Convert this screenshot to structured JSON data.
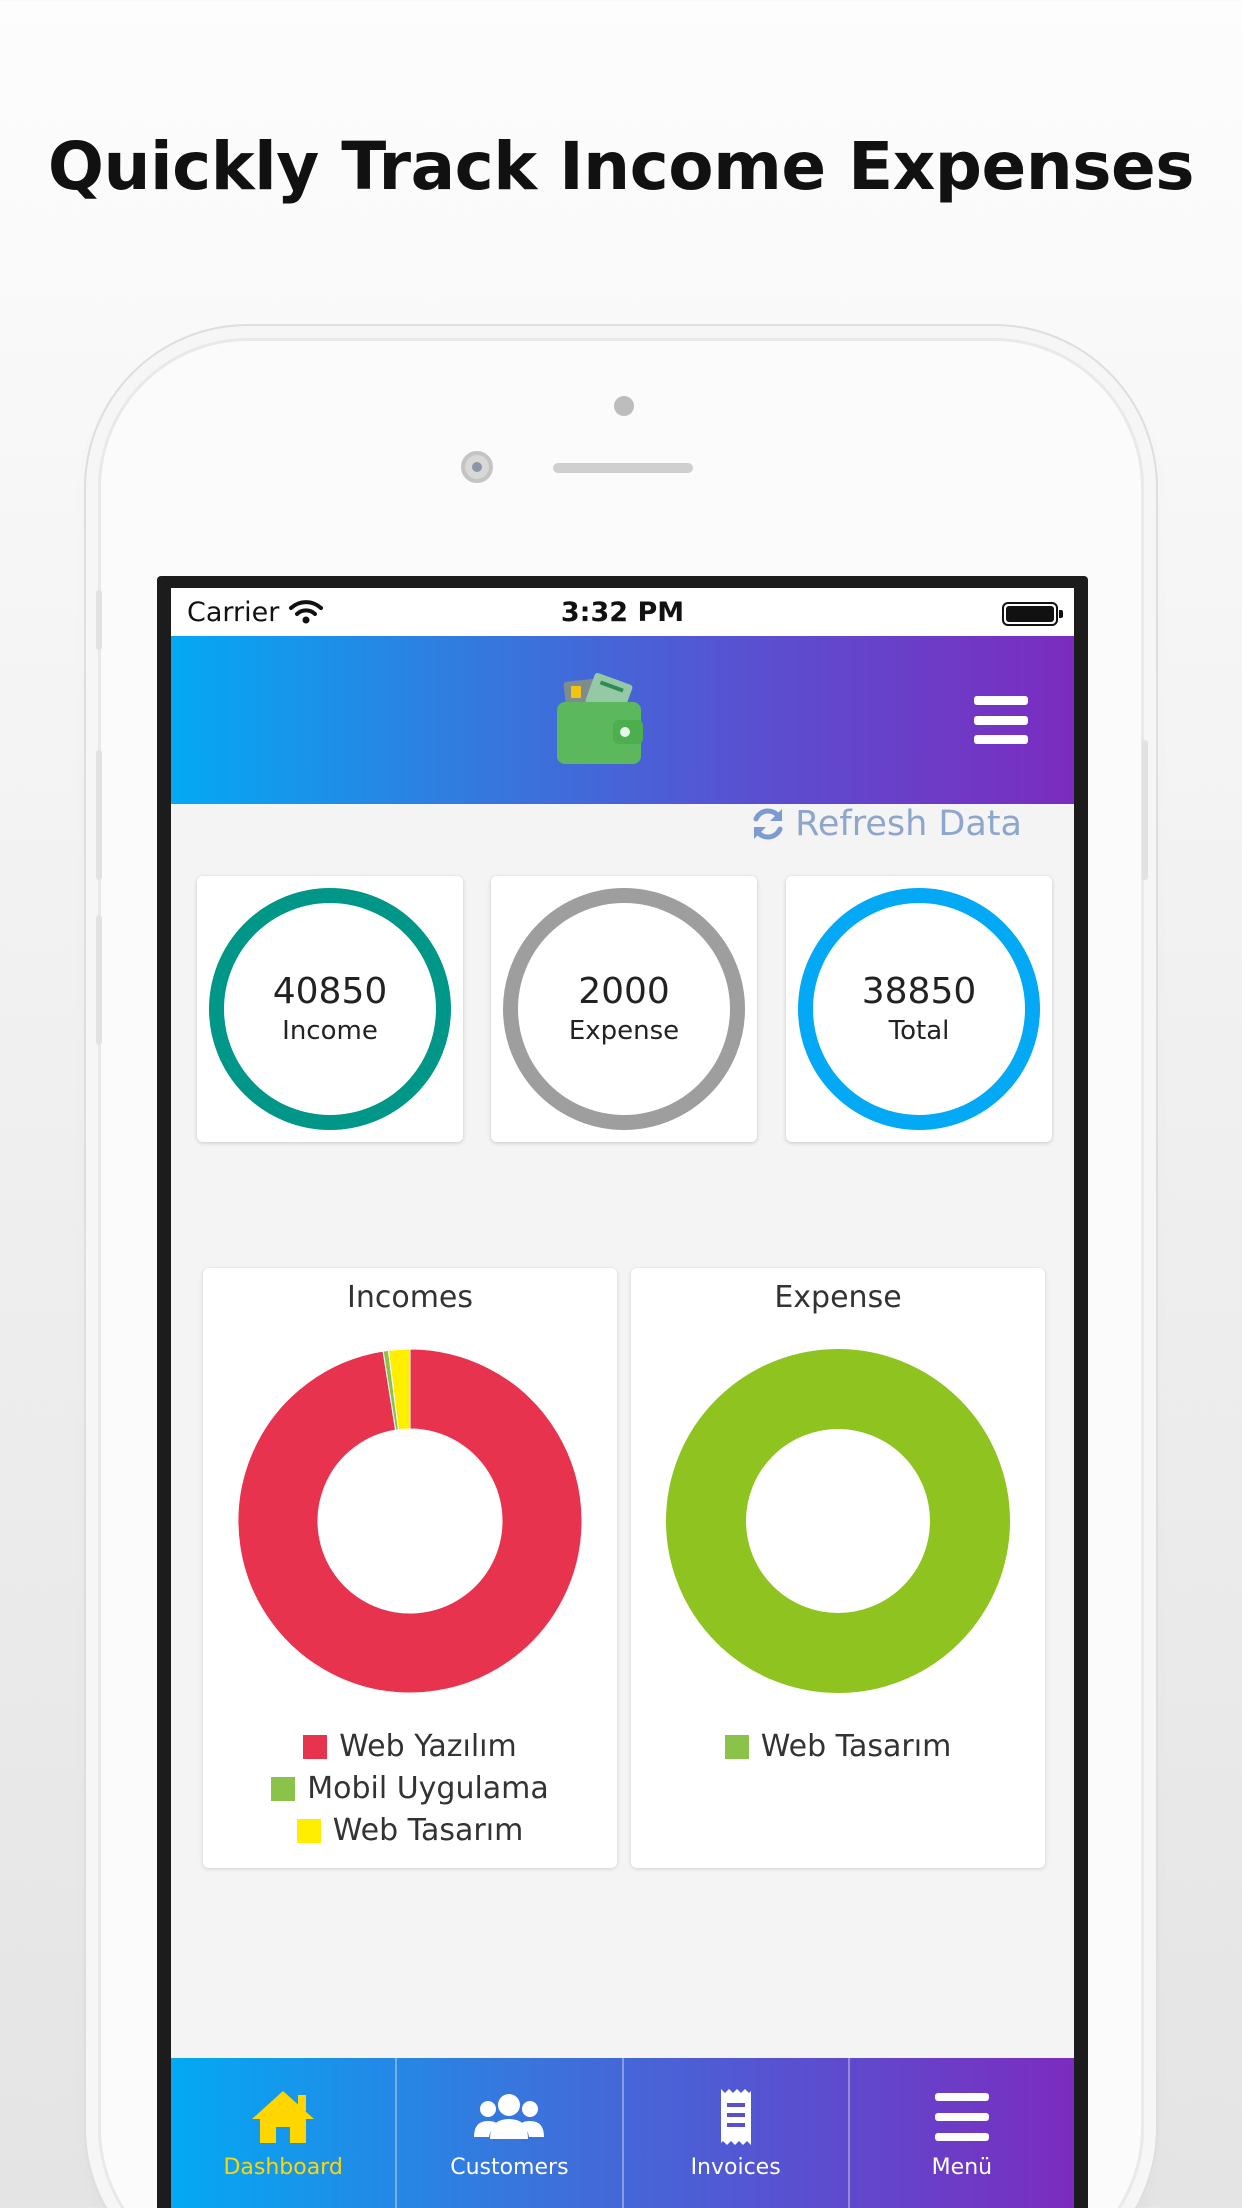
{
  "headline": "Quickly Track Income Expenses",
  "status_bar": {
    "carrier": "Carrier",
    "time": "3:32 PM"
  },
  "app_bar": {
    "logo_icon": "wallet-icon",
    "menu_icon": "hamburger-icon"
  },
  "refresh": {
    "label": "Refresh Data",
    "icon": "refresh-icon"
  },
  "stats": [
    {
      "value": "40850",
      "label": "Income",
      "color": "#009688"
    },
    {
      "value": "2000",
      "label": "Expense",
      "color": "#9e9e9e"
    },
    {
      "value": "38850",
      "label": "Total",
      "color": "#03a9f4"
    }
  ],
  "charts": {
    "incomes": {
      "title": "Incomes",
      "legend": [
        {
          "label": "Web Yazılım",
          "color": "#e8334f"
        },
        {
          "label": "Mobil Uygulama",
          "color": "#8bc34a"
        },
        {
          "label": "Web Tasarım",
          "color": "#ffee00"
        }
      ]
    },
    "expense": {
      "title": "Expense",
      "legend": [
        {
          "label": "Web Tasarım",
          "color": "#8bc34a"
        }
      ]
    }
  },
  "chart_data": [
    {
      "type": "pie",
      "title": "Incomes",
      "categories": [
        "Web Yazılım",
        "Mobil Uygulama",
        "Web Tasarım"
      ],
      "values": [
        97.5,
        0.5,
        2
      ],
      "colors": [
        "#e8334f",
        "#8bc34a",
        "#ffee00"
      ],
      "donut": true
    },
    {
      "type": "pie",
      "title": "Expense",
      "categories": [
        "Web Tasarım"
      ],
      "values": [
        100
      ],
      "colors": [
        "#8fc31f"
      ],
      "donut": true
    }
  ],
  "tabs": [
    {
      "label": "Dashboard",
      "icon": "home-icon",
      "active": true
    },
    {
      "label": "Customers",
      "icon": "users-icon",
      "active": false
    },
    {
      "label": "Invoices",
      "icon": "receipt-icon",
      "active": false
    },
    {
      "label": "Menü",
      "icon": "menu-icon",
      "active": false
    }
  ]
}
